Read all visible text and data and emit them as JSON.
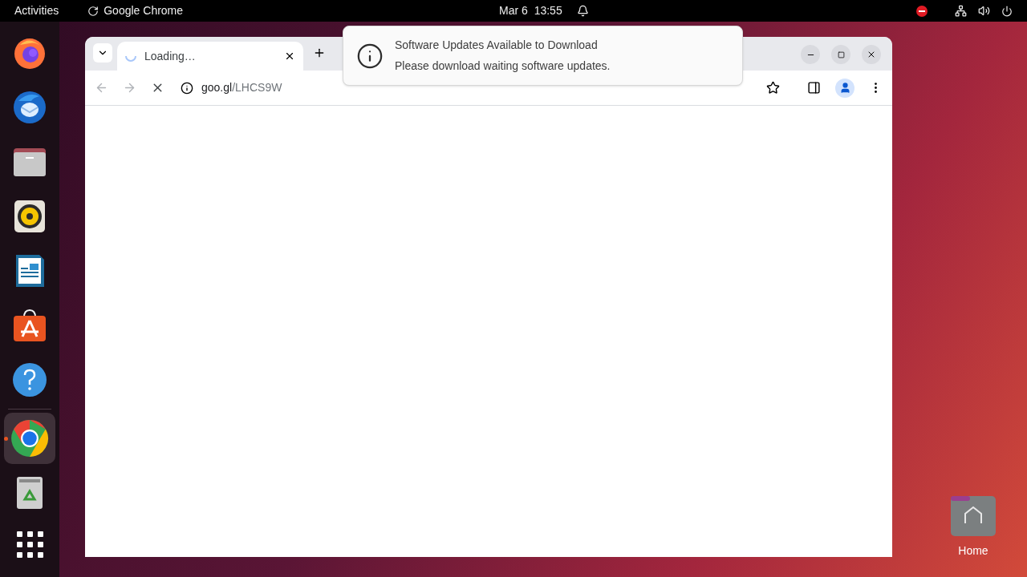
{
  "top_bar": {
    "activities": "Activities",
    "app_name": "Google Chrome",
    "date": "Mar 6",
    "time": "13:55"
  },
  "dock": [
    {
      "selected": false,
      "running": false
    },
    {
      "selected": false,
      "running": false
    },
    {
      "selected": false,
      "running": false
    },
    {
      "selected": false,
      "running": false
    },
    {
      "selected": false,
      "running": false
    },
    {
      "selected": false,
      "running": false
    },
    {
      "selected": false,
      "running": false
    },
    {
      "selected": true,
      "running": true
    },
    {
      "selected": false,
      "running": false
    }
  ],
  "browser": {
    "tabs": [
      {
        "title": "Loading…",
        "loading": true,
        "selected": true
      }
    ],
    "address": {
      "host": "goo.gl",
      "path": "/LHCS9W"
    },
    "loading": true
  },
  "notification": {
    "title": "Software Updates Available to Download",
    "body": "Please download waiting software updates."
  },
  "desktop_icons": [
    {
      "label": "Home"
    }
  ]
}
